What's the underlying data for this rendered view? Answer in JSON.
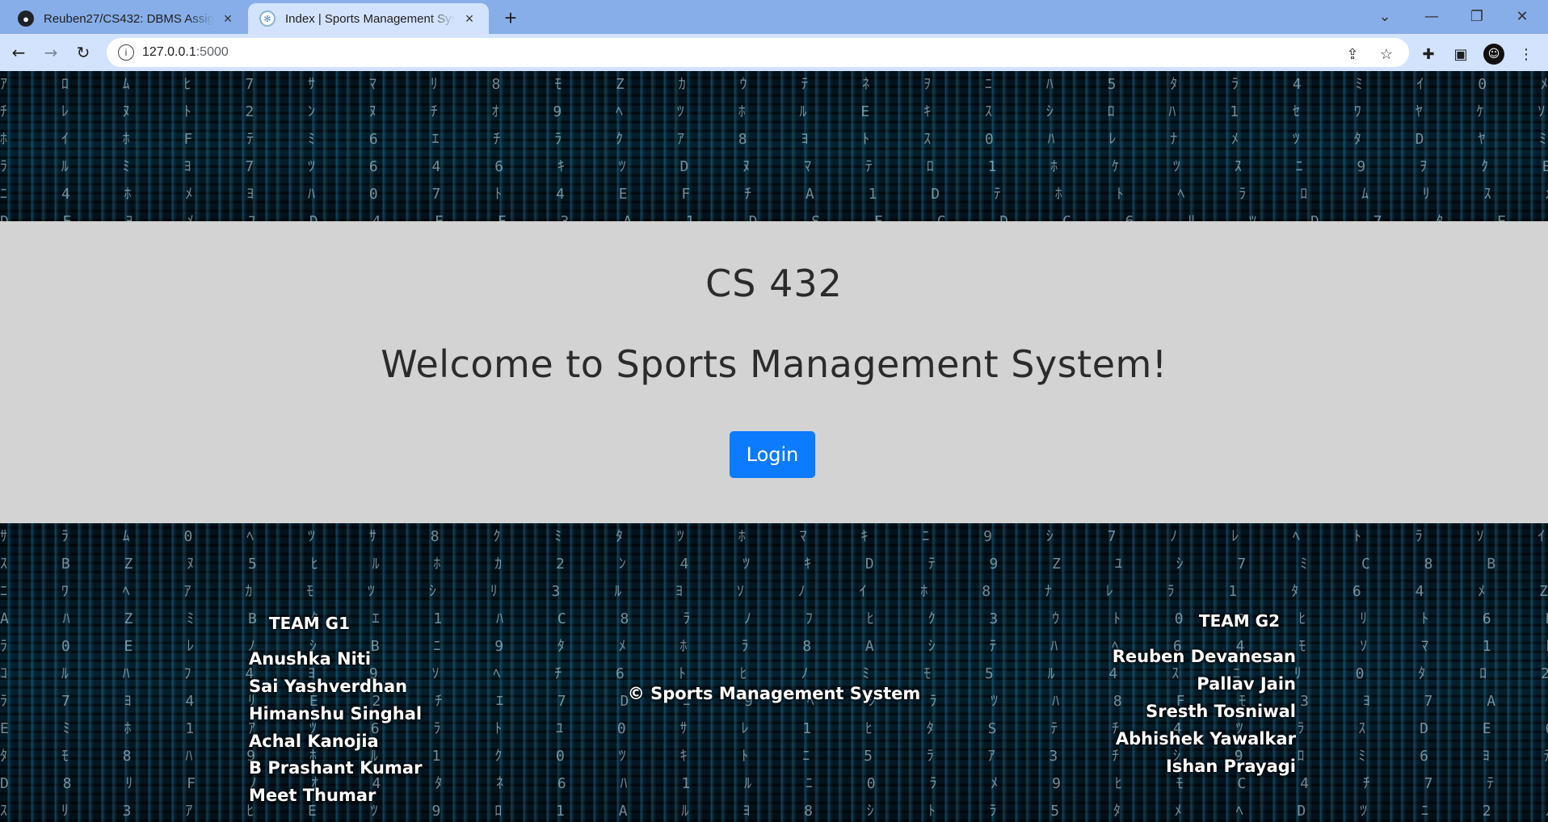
{
  "browser": {
    "tabs": [
      {
        "title": "Reuben27/CS432: DBMS Assignm",
        "favicon": "github-icon"
      },
      {
        "title": "Index | Sports Management Syste",
        "favicon": "globe-icon"
      }
    ],
    "new_tab": "+",
    "url_host": "127.0.0.1",
    "url_port": ":5000"
  },
  "hero": {
    "course": "CS 432",
    "welcome": "Welcome to Sports Management System!",
    "login_label": "Login"
  },
  "footer": {
    "copyright": "© Sports Management System",
    "team_g1": {
      "title": "TEAM G1",
      "members": [
        "Anushka Niti",
        "Sai Yashverdhan",
        "Himanshu Singhal",
        "Achal Kanojia",
        "B Prashant Kumar",
        "Meet Thumar"
      ]
    },
    "team_g2": {
      "title": "TEAM G2",
      "members": [
        "Reuben Devanesan",
        "Pallav Jain",
        "Sresth Tosniwal",
        "Abhishek Yawalkar",
        "Ishan Prayagi"
      ]
    }
  },
  "colors": {
    "accent": "#0d7bff",
    "hero_bg": "#d3d3d3",
    "tab_strip": "#87aee9"
  }
}
